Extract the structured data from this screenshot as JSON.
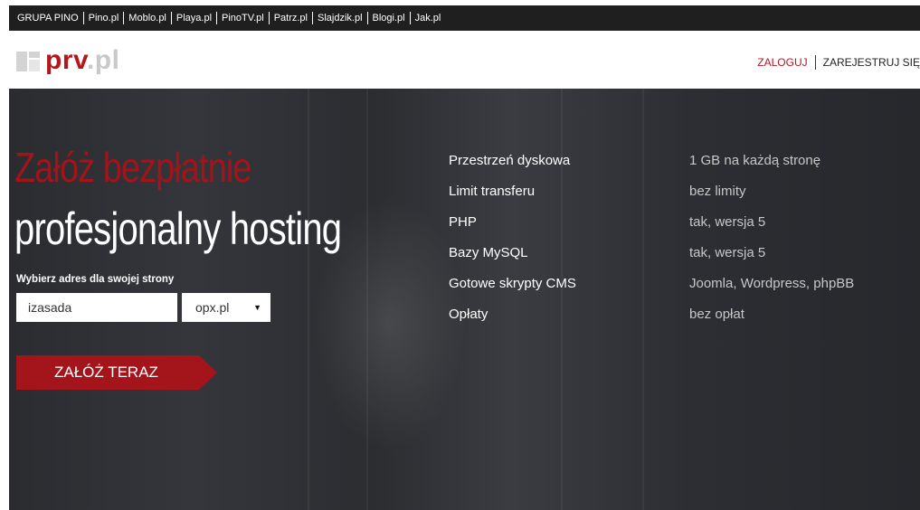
{
  "topbar": {
    "group_label": "GRUPA PINO",
    "links": [
      "Pino.pl",
      "Moblo.pl",
      "Playa.pl",
      "PinoTV.pl",
      "Patrz.pl",
      "Slajdzik.pl",
      "Blogi.pl",
      "Jak.pl"
    ]
  },
  "header": {
    "logo_main": "prv",
    "logo_tld": ".pl",
    "login_label": "ZALOGUJ",
    "register_label": "ZAREJESTRUJ SIĘ"
  },
  "hero": {
    "headline_red": "Załóż bezpłatnie",
    "headline_white": "profesjonalny hosting",
    "choose_label": "Wybierz adres dla swojej strony",
    "address_value": "izasada",
    "domain_selected": "opx.pl",
    "cta_label": "ZAŁÓŻ TERAZ"
  },
  "features": [
    {
      "label": "Przestrzeń dyskowa",
      "value": "1 GB na każdą stronę"
    },
    {
      "label": "Limit transferu",
      "value": "bez limity"
    },
    {
      "label": "PHP",
      "value": "tak, wersja 5"
    },
    {
      "label": "Bazy MySQL",
      "value": "tak, wersja 5"
    },
    {
      "label": "Gotowe skrypty CMS",
      "value": "Joomla, Wordpress, phpBB"
    },
    {
      "label": "Opłaty",
      "value": "bez opłat"
    }
  ],
  "colors": {
    "brand_red": "#b8141c",
    "cta_red": "#a4141b",
    "topbar_bg": "#1f1f1f",
    "hero_bg": "#2e3034"
  }
}
